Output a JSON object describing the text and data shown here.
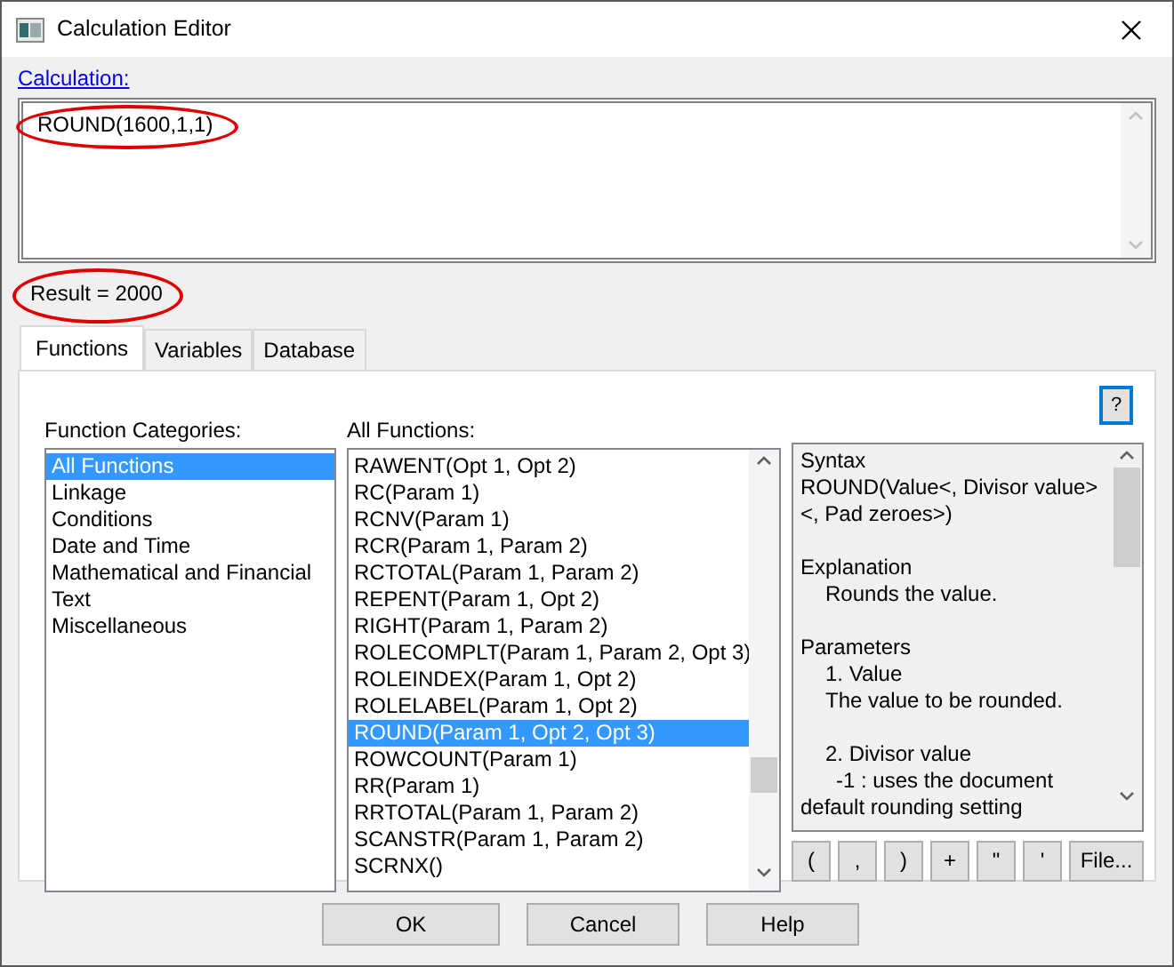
{
  "window": {
    "title": "Calculation Editor"
  },
  "calculation": {
    "label": "Calculation:",
    "value": "ROUND(1600,1,1)",
    "circled": true
  },
  "result": {
    "text": "Result = 2000",
    "circled": true
  },
  "tabs": [
    {
      "label": "Functions",
      "selected": true
    },
    {
      "label": "Variables",
      "selected": false
    },
    {
      "label": "Database",
      "selected": false
    }
  ],
  "help_button": "?",
  "categories": {
    "label": "Function Categories:",
    "items": [
      {
        "text": "All Functions",
        "selected": true
      },
      {
        "text": "Linkage",
        "selected": false
      },
      {
        "text": "Conditions",
        "selected": false
      },
      {
        "text": "Date and Time",
        "selected": false
      },
      {
        "text": "Mathematical and Financial",
        "selected": false
      },
      {
        "text": "Text",
        "selected": false
      },
      {
        "text": "Miscellaneous",
        "selected": false
      }
    ]
  },
  "functions": {
    "label": "All Functions:",
    "items": [
      {
        "text": "RAWENT(Opt 1, Opt 2)",
        "selected": false
      },
      {
        "text": "RC(Param 1)",
        "selected": false
      },
      {
        "text": "RCNV(Param 1)",
        "selected": false
      },
      {
        "text": "RCR(Param 1, Param 2)",
        "selected": false
      },
      {
        "text": "RCTOTAL(Param 1, Param 2)",
        "selected": false
      },
      {
        "text": "REPENT(Param 1, Opt 2)",
        "selected": false
      },
      {
        "text": "RIGHT(Param 1, Param 2)",
        "selected": false
      },
      {
        "text": "ROLECOMPLT(Param 1, Param 2, Opt 3)",
        "selected": false
      },
      {
        "text": "ROLEINDEX(Param 1, Opt 2)",
        "selected": false
      },
      {
        "text": "ROLELABEL(Param 1, Opt 2)",
        "selected": false
      },
      {
        "text": "ROUND(Param 1, Opt 2, Opt 3)",
        "selected": true
      },
      {
        "text": "ROWCOUNT(Param 1)",
        "selected": false
      },
      {
        "text": "RR(Param 1)",
        "selected": false
      },
      {
        "text": "RRTOTAL(Param 1, Param 2)",
        "selected": false
      },
      {
        "text": "SCANSTR(Param 1, Param 2)",
        "selected": false
      },
      {
        "text": "SCRNX()",
        "selected": false
      }
    ]
  },
  "description": [
    {
      "kind": "plain",
      "text": "Syntax"
    },
    {
      "kind": "plain",
      "text": "ROUND(Value<, Divisor value><, Pad zeroes>)"
    },
    {
      "kind": "gap"
    },
    {
      "kind": "plain",
      "text": "Explanation"
    },
    {
      "kind": "indent",
      "text": "Rounds the value."
    },
    {
      "kind": "gap"
    },
    {
      "kind": "plain",
      "text": "Parameters"
    },
    {
      "kind": "indent",
      "text": "1. Value"
    },
    {
      "kind": "indent",
      "text": "The value to be rounded."
    },
    {
      "kind": "gap"
    },
    {
      "kind": "indent",
      "text": "2. Divisor value"
    },
    {
      "kind": "hanging",
      "text": "-1 : uses the document default rounding setting"
    }
  ],
  "insert_buttons": [
    "(",
    ",",
    ")",
    "+",
    "\"",
    "'",
    "File..."
  ],
  "buttons": [
    "OK",
    "Cancel",
    "Help"
  ]
}
